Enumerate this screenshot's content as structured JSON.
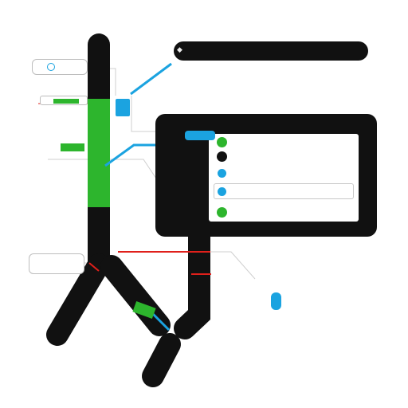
{
  "colors": {
    "track": "#111111",
    "green": "#2db52d",
    "blue": "#1ba3e0",
    "red": "#e0201b",
    "panel_bg": "#ffffff",
    "outline": "#bdbdbd"
  },
  "icons": {
    "header_left": "dot-icon",
    "header_right": "pen-icon",
    "row_status": "status-dot-icon",
    "connector": "pin-icon"
  },
  "header_bar": {
    "left_glyph": "◆"
  },
  "panel": {
    "header_title": "",
    "rows": [
      {
        "color": "green",
        "label": "",
        "value": ""
      },
      {
        "color": "dark",
        "label": "",
        "value": ""
      },
      {
        "color": "blue",
        "label": "",
        "value": ""
      },
      {
        "color": "blue",
        "label": "",
        "value": ""
      },
      {
        "color": "green",
        "label": "",
        "value": ""
      }
    ],
    "footer_left": "",
    "footer_right": ""
  },
  "callouts": {
    "top_left": "",
    "green_tab": "",
    "lower_left": ""
  }
}
